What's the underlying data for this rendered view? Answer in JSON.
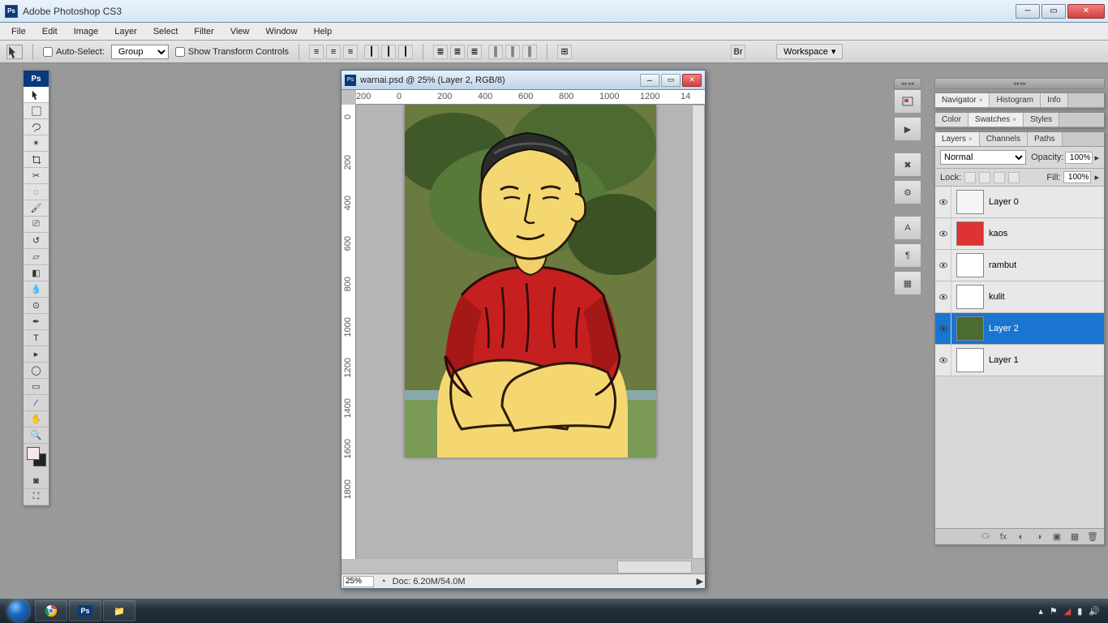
{
  "app": {
    "title": "Adobe Photoshop CS3"
  },
  "menu": [
    "File",
    "Edit",
    "Image",
    "Layer",
    "Select",
    "Filter",
    "View",
    "Window",
    "Help"
  ],
  "options": {
    "autoselect_label": "Auto-Select:",
    "autoselect_value": "Group",
    "transform_label": "Show Transform Controls",
    "workspace_label": "Workspace"
  },
  "document": {
    "title": "warnai.psd @ 25% (Layer 2, RGB/8)",
    "zoom": "25%",
    "docinfo": "Doc: 6.20M/54.0M",
    "ruler_h": [
      "200",
      "0",
      "200",
      "400",
      "600",
      "800",
      "1000",
      "1200",
      "14"
    ],
    "ruler_v": [
      "0",
      "200",
      "400",
      "600",
      "800",
      "1000",
      "1200",
      "1400",
      "1600",
      "1800"
    ]
  },
  "panel_nav": {
    "tabs": [
      "Navigator",
      "Histogram",
      "Info"
    ]
  },
  "panel_color": {
    "tabs": [
      "Color",
      "Swatches",
      "Styles"
    ]
  },
  "panel_layers": {
    "tabs": [
      "Layers",
      "Channels",
      "Paths"
    ],
    "blendmode": "Normal",
    "opacity_label": "Opacity:",
    "opacity_value": "100%",
    "lock_label": "Lock:",
    "fill_label": "Fill:",
    "fill_value": "100%",
    "layers": [
      {
        "name": "Layer 0",
        "selected": false,
        "thumb": "sketch"
      },
      {
        "name": "kaos",
        "selected": false,
        "thumb": "red"
      },
      {
        "name": "rambut",
        "selected": false,
        "thumb": "chess"
      },
      {
        "name": "kulit",
        "selected": false,
        "thumb": "chess"
      },
      {
        "name": "Layer 2",
        "selected": true,
        "thumb": "green"
      },
      {
        "name": "Layer 1",
        "selected": false,
        "thumb": "white"
      }
    ]
  }
}
